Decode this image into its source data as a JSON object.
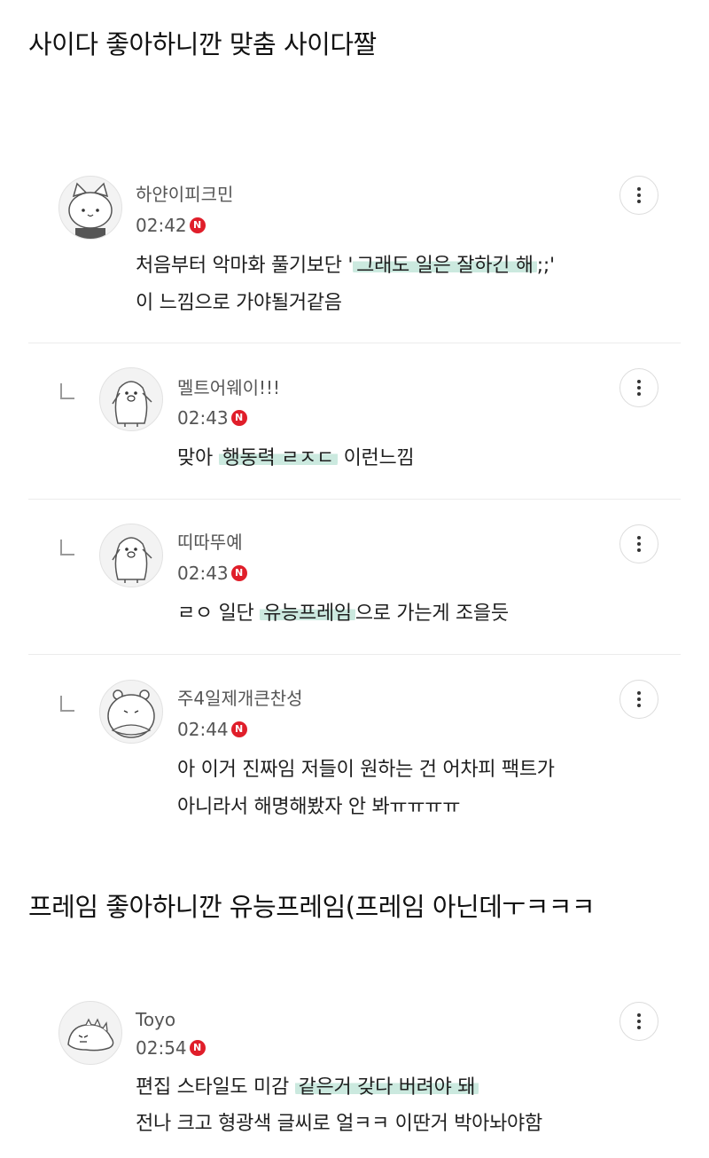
{
  "headlines": {
    "first": "사이다 좋아하니깐 맞춤 사이다짤",
    "second": "프레임 좋아하니깐 유능프레임(프레임 아닌데ㅜㅋㅋㅋ"
  },
  "new_badge": "N",
  "colors": {
    "badge": "#e01e2a",
    "highlight": "#bae2d4"
  },
  "comments": [
    {
      "nickname": "하얀이피크민",
      "time": "02:42",
      "avatar_icon": "cat-avatar-icon",
      "line1_pre": "처음부터 악마화 풀기보단 '",
      "line1_hl": "그래도 일은 잘하긴 해",
      "line1_post": ";;'",
      "line2": "이 느낌으로 가야될거같음"
    },
    {
      "nickname": "멜트어웨이!!!",
      "time": "02:43",
      "avatar_icon": "penguin-avatar-icon",
      "line1_pre": "맞아 ",
      "line1_hl": "행동력 ㄹㅈㄷ",
      "line1_post": " 이런느낌"
    },
    {
      "nickname": "띠따뚜예",
      "time": "02:43",
      "avatar_icon": "penguin-avatar-icon",
      "line1_pre": "ㄹㅇ 일단 ",
      "line1_hl": "유능프레임",
      "line1_post": "으로 가는게 조을듯"
    },
    {
      "nickname": "주4일제개큰찬성",
      "time": "02:44",
      "avatar_icon": "hamster-avatar-icon",
      "line1": "아 이거 진짜임 저들이 원하는 건 어차피 팩트가",
      "line2": "아니라서 해명해봤자 안 봐ㅠㅠㅠㅠ"
    },
    {
      "nickname": "Toyo",
      "time": "02:54",
      "avatar_icon": "dinosaur-avatar-icon",
      "line1_pre": "편집 스타일도 미감 ",
      "line1_hl": "같은거 갖다 버려야 돼",
      "line1_post": "",
      "line2": "전나 크고 형광색 글씨로 얼ㅋㅋ 이딴거 박아놔야함"
    }
  ]
}
